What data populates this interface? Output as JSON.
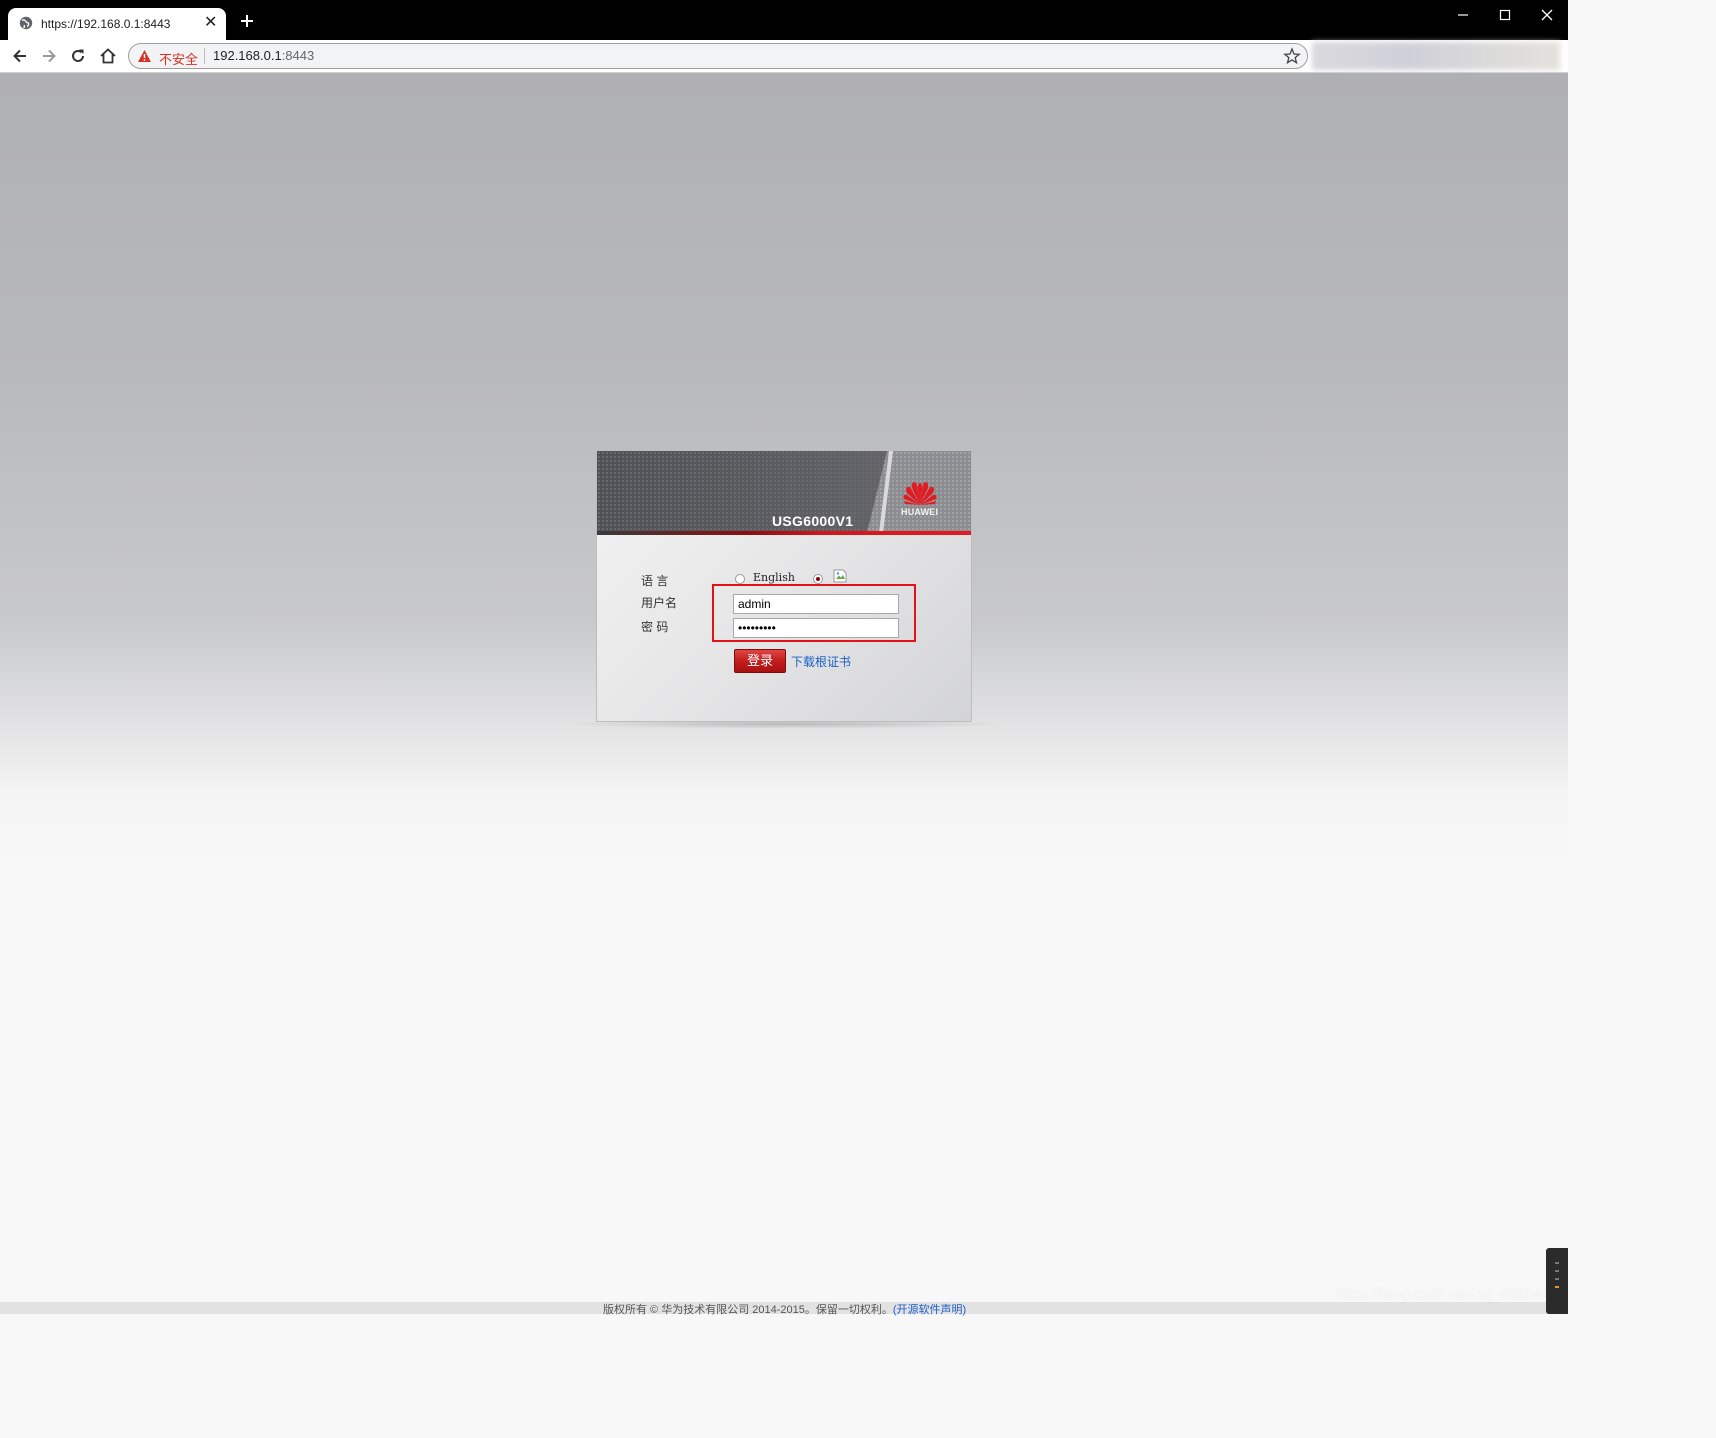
{
  "browser": {
    "tab": {
      "title": "https://192.168.0.1:8443"
    },
    "address_bar": {
      "security_label": "不安全",
      "host": "192.168.0.1",
      "port": ":8443"
    },
    "icons": {
      "favicon": "globe-icon",
      "new_tab": "plus-icon",
      "back": "arrow-left-icon",
      "forward": "arrow-right-icon",
      "reload": "reload-icon",
      "home": "home-icon",
      "security": "warning-icon",
      "bookmark": "star-icon",
      "minimize": "minimize-icon",
      "maximize": "maximize-icon",
      "close": "close-icon"
    }
  },
  "login": {
    "product_name": "USG6000V1",
    "brand": "HUAWEI",
    "language_label": "语  言",
    "languages": [
      {
        "label": "English",
        "selected": false
      },
      {
        "label": "",
        "selected": true
      }
    ],
    "username_label": "用户名",
    "username_value": "admin",
    "password_label": "密  码",
    "password_value": "•••••••••",
    "login_button": "登录",
    "download_cert_link": "下载根证书"
  },
  "footer": {
    "copyright": "版权所有 © 华为技术有限公司 2014-2015。保留一切权利。",
    "open_source_link": "(开源软件声明)"
  },
  "watermark": "https://blog.csdn.net/qq_46254436",
  "colors": {
    "brand_red": "#e21b22",
    "highlight_red": "#e3111a",
    "link_blue": "#1a5fc8",
    "insecure_red": "#d93025"
  }
}
